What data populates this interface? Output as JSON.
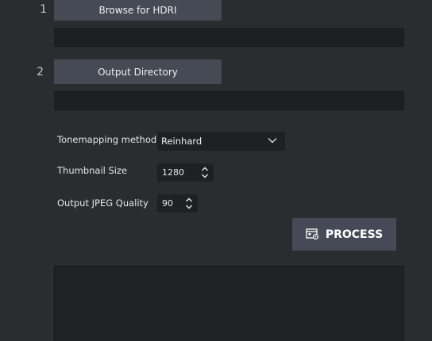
{
  "steps": {
    "step1": {
      "number": "1",
      "button_label": "Browse for HDRI",
      "path_value": ""
    },
    "step2": {
      "number": "2",
      "button_label": "Output Directory",
      "path_value": ""
    }
  },
  "settings": {
    "tonemapping": {
      "label": "Tonemapping method:",
      "value": "Reinhard",
      "icon": "chevron-down-icon"
    },
    "thumbnail_size": {
      "label": "Thumbnail Size",
      "value": "1280",
      "icon": "spinner-arrows-icon"
    },
    "jpeg_quality": {
      "label": "Output JPEG Quality",
      "value": "90",
      "icon": "spinner-arrows-icon"
    }
  },
  "process": {
    "label": "PROCESS",
    "icon": "process-icon"
  },
  "log": {
    "text": ""
  },
  "colors": {
    "background": "#2a2c30",
    "button": "#464a54",
    "field": "#1e1f22"
  }
}
